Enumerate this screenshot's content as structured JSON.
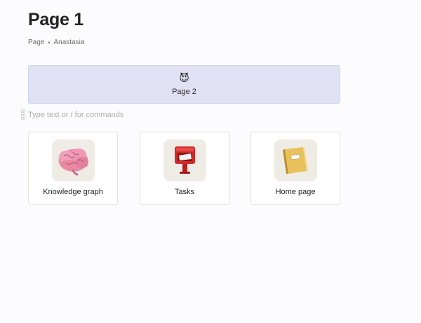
{
  "page": {
    "title": "Page 1",
    "type_label": "Page",
    "separator": "•",
    "author": "Anastasia"
  },
  "linked_page": {
    "emoji": "😈",
    "label": "Page 2"
  },
  "editor": {
    "placeholder": "Type text or / for commands",
    "value": ""
  },
  "tiles": [
    {
      "label": "Knowledge graph",
      "icon": "brain-icon"
    },
    {
      "label": "Tasks",
      "icon": "postbox-icon"
    },
    {
      "label": "Home page",
      "icon": "ledger-icon"
    }
  ],
  "colors": {
    "link_card_bg": "#e1e1f5",
    "tile_border": "#e6e1d6",
    "icon_box_bg": "#efece6"
  }
}
